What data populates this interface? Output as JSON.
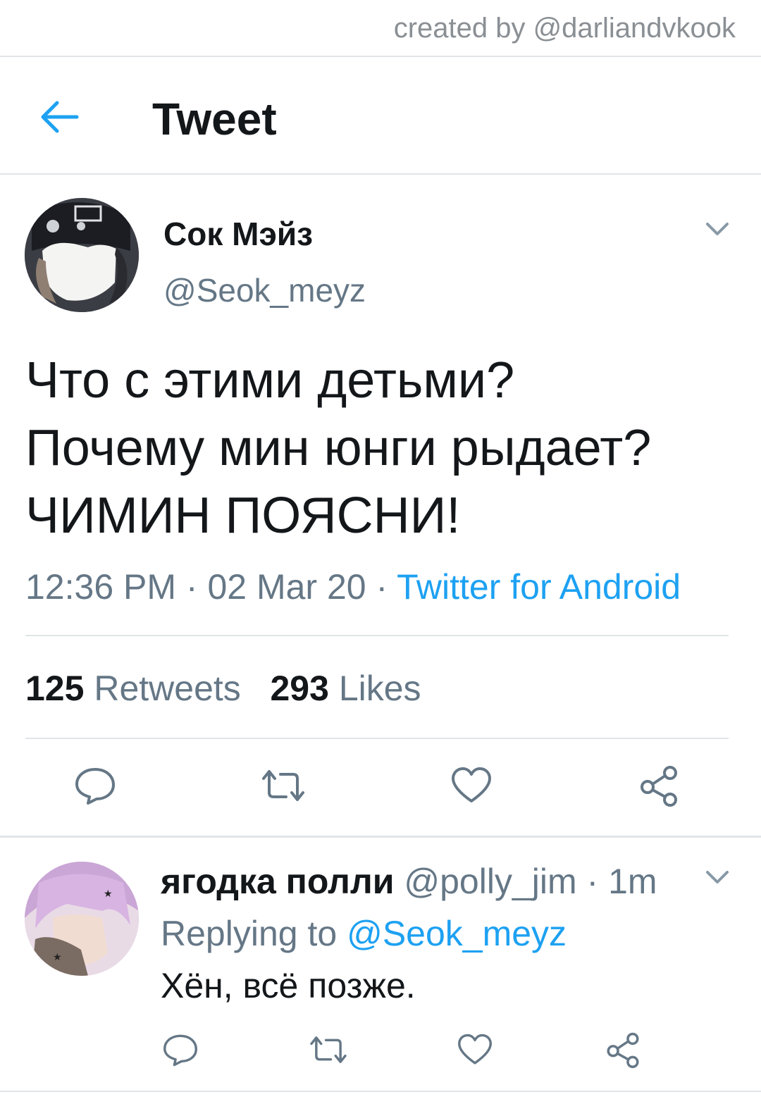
{
  "credit": "created by @darliandvkook",
  "header": {
    "title": "Tweet",
    "back_icon": "arrow-left-icon"
  },
  "tweet": {
    "display_name": "Сок Мэйз",
    "handle": "@Seok_meyz",
    "lines": [
      "Что с этими детьми?",
      "Почему мин юнги рыдает?",
      "ЧИМИН ПОЯСНИ!"
    ],
    "time": "12:36 PM",
    "date": "02 Mar 20",
    "separator": " · ",
    "source": "Twitter for Android",
    "retweets_count": "125",
    "retweets_label": "Retweets",
    "likes_count": "293",
    "likes_label": "Likes"
  },
  "reply": {
    "display_name": "ягодка полли",
    "handle": "@polly_jim",
    "time": "1m",
    "replying_label": "Replying to",
    "replying_to": "@Seok_meyz",
    "text": "Хён, всё позже."
  },
  "colors": {
    "accent": "#1da1f2",
    "muted": "#657786",
    "divider": "#e1e5e8"
  }
}
